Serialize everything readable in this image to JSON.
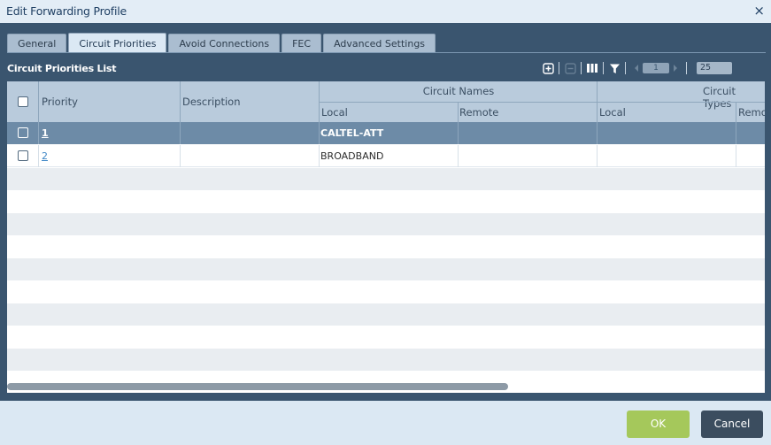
{
  "dialog": {
    "title": "Edit Forwarding Profile",
    "close_glyph": "×"
  },
  "tabs": [
    {
      "label": "General",
      "active": false
    },
    {
      "label": "Circuit Priorities",
      "active": true
    },
    {
      "label": "Avoid Connections",
      "active": false
    },
    {
      "label": "FEC",
      "active": false
    },
    {
      "label": "Advanced Settings",
      "active": false
    }
  ],
  "section": {
    "title": "Circuit Priorities List"
  },
  "toolbar": {
    "icons": [
      "add-icon",
      "remove-icon",
      "columns-icon",
      "filter-icon",
      "prev-page-icon",
      "next-page-icon"
    ],
    "page": "1",
    "page_size": "25"
  },
  "table": {
    "headers": {
      "priority": "Priority",
      "description": "Description",
      "circuit_names": "Circuit Names",
      "circuit_types": "Circuit Types",
      "local": "Local",
      "remote": "Remote",
      "types_local": "Local",
      "types_remote": "Remo"
    },
    "rows": [
      {
        "priority": "1",
        "description": "",
        "circuit_local": "CALTEL-ATT",
        "circuit_remote": "",
        "type_local": "",
        "type_remote": "",
        "selected": true
      },
      {
        "priority": "2",
        "description": "",
        "circuit_local": "BROADBAND",
        "circuit_remote": "",
        "type_local": "",
        "type_remote": "",
        "selected": false
      }
    ]
  },
  "footer": {
    "ok_label": "OK",
    "cancel_label": "Cancel"
  },
  "colors": {
    "frame": "#3a556f",
    "header": "#b9cbdc",
    "selected_row": "#6d8ba7",
    "ok": "#a5c85b",
    "cancel": "#3b4d5f"
  }
}
